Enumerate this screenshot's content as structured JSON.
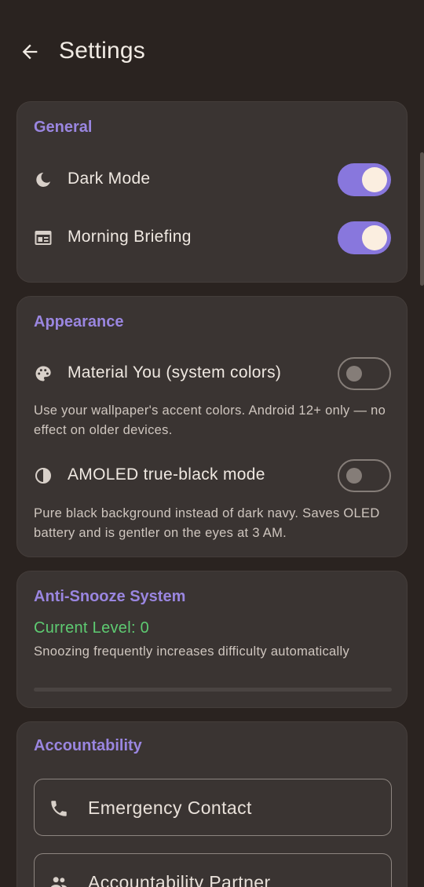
{
  "header": {
    "title": "Settings",
    "back_icon": "arrow-left-icon"
  },
  "general": {
    "title": "General",
    "dark_mode": {
      "label": "Dark Mode",
      "icon": "moon-icon",
      "enabled": true
    },
    "morning_briefing": {
      "label": "Morning Briefing",
      "icon": "newspaper-icon",
      "enabled": true
    }
  },
  "appearance": {
    "title": "Appearance",
    "material_you": {
      "label": "Material You (system colors)",
      "icon": "palette-icon",
      "enabled": false,
      "description": "Use your wallpaper's accent colors. Android 12+ only — no effect on older devices."
    },
    "amoled": {
      "label": "AMOLED true-black mode",
      "icon": "contrast-icon",
      "enabled": false,
      "description": "Pure black background instead of dark navy. Saves OLED battery and is gentler on the eyes at 3 AM."
    }
  },
  "anti_snooze": {
    "title": "Anti-Snooze System",
    "current_level": "Current Level: 0",
    "description": "Snoozing frequently increases difficulty automatically",
    "progress": 0
  },
  "accountability": {
    "title": "Accountability",
    "emergency_contact": {
      "label": "Emergency Contact",
      "icon": "phone-icon"
    },
    "partner": {
      "label": "Accountability Partner",
      "icon": "people-icon"
    }
  },
  "colors": {
    "background": "#2a2320",
    "card": "#3a3432",
    "accent": "#9a86e0",
    "toggle_on": "#8877dd",
    "level_green": "#5ecb72"
  }
}
